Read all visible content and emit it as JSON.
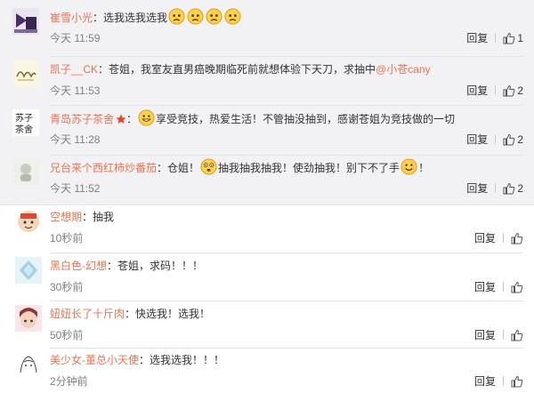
{
  "comments_top": [
    {
      "user": "崔雪小光",
      "text": "选我选我选我",
      "time": "今天 11:59",
      "reply": "回复",
      "likes": "1"
    },
    {
      "user": "凯子__CK",
      "text_before": "苍姐，我室友直男癌晚期临死前就想体验下天刀，求抽中",
      "mention": "@小苍cany",
      "time": "今天 11:53",
      "reply": "回复",
      "likes": "2"
    },
    {
      "user": "青岛苏子茶舍",
      "text": "享受竞技，热爱生活！不管抽没抽到，感谢苍姐为竞技做的一切",
      "time": "今天 11:28",
      "reply": "回复",
      "likes": "2"
    },
    {
      "user": "兄台来个西红柿炒番茄",
      "text_a": "仓姐！",
      "text_b": "抽我抽我抽我！使劲抽我！别下不了手",
      "text_c": "！",
      "time": "今天 11:52",
      "reply": "回复",
      "likes": "2"
    }
  ],
  "comments_bottom": [
    {
      "user": "空想期",
      "text": "抽我",
      "time": "10秒前",
      "reply": "回复"
    },
    {
      "user": "黑白色-幻想",
      "text": "苍姐，求码！！！",
      "time": "30秒前",
      "reply": "回复"
    },
    {
      "user": "妞妞长了十斤肉",
      "text": "快选我！选我！",
      "time": "50秒前",
      "reply": "回复"
    },
    {
      "user": "美少女-董总小天使",
      "text": "选我选我！！！",
      "time": "2分钟前",
      "reply": "回复"
    }
  ],
  "icons": {
    "like": "thumbs-up-icon",
    "emoji": "face-emoji-icon",
    "vip": "red-star-icon"
  },
  "colors": {
    "username": "#eb7350",
    "text": "#333333",
    "time": "#808080",
    "panel_bg": "#f2f2f5"
  }
}
